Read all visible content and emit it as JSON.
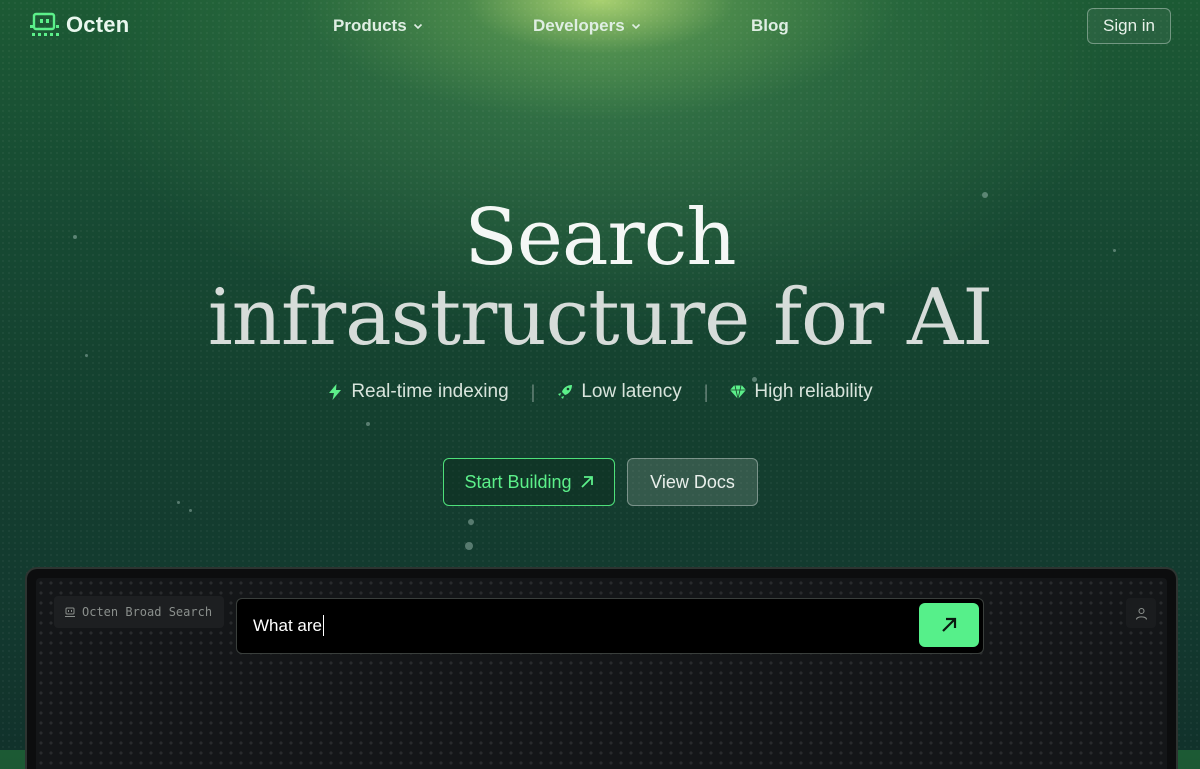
{
  "brand": {
    "name": "Octen"
  },
  "nav": {
    "items": [
      {
        "label": "Products",
        "has_dropdown": true
      },
      {
        "label": "Developers",
        "has_dropdown": true
      },
      {
        "label": "Blog",
        "has_dropdown": false
      }
    ],
    "signin_label": "Sign in"
  },
  "hero": {
    "title_line1": "Search",
    "title_line2": "infrastructure for AI",
    "features": [
      {
        "label": "Real-time indexing",
        "icon": "bolt-icon"
      },
      {
        "label": "Low latency",
        "icon": "rocket-icon"
      },
      {
        "label": "High reliability",
        "icon": "diamond-icon"
      }
    ],
    "primary_cta": "Start Building",
    "secondary_cta": "View Docs"
  },
  "demo": {
    "label": "Octen Broad Search",
    "query": "What are"
  },
  "colors": {
    "accent": "#56f08a",
    "background_top": "#1c5a34",
    "background_bottom": "#11322b",
    "panel": "#0c0d0e"
  }
}
